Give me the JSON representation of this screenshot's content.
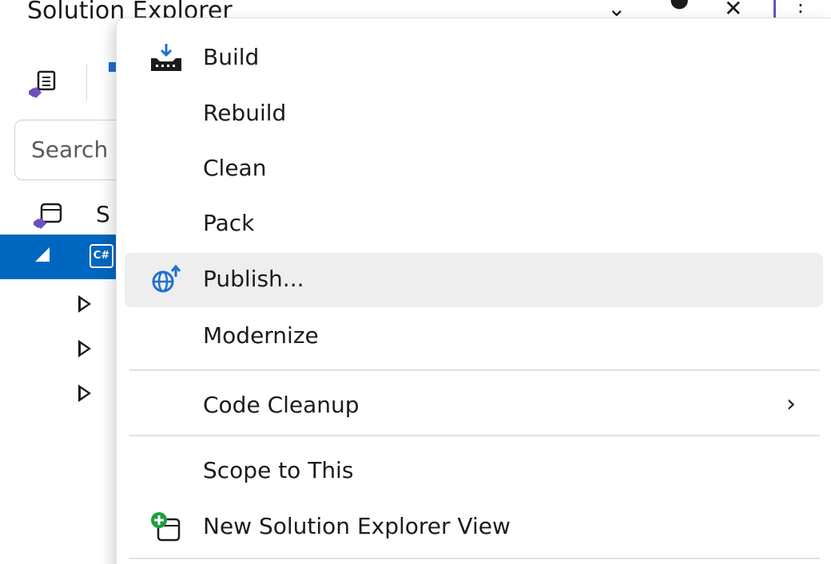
{
  "panel": {
    "title": "Solution Explorer",
    "search_placeholder": "Search",
    "solution_label_partial": "S",
    "project_icon_text": "C#"
  },
  "context_menu": {
    "items": [
      {
        "label": "Build",
        "icon": "build-icon"
      },
      {
        "label": "Rebuild"
      },
      {
        "label": "Clean"
      },
      {
        "label": "Pack"
      },
      {
        "label": "Publish...",
        "icon": "publish-globe-icon",
        "hovered": true
      },
      {
        "label": "Modernize"
      },
      {
        "label": "Code Cleanup",
        "has_submenu": true
      },
      {
        "label": "Scope to This"
      },
      {
        "label": "New Solution Explorer View",
        "icon": "new-view-icon"
      }
    ]
  },
  "colors": {
    "selection": "#0067c0",
    "hover": "#eeeeee",
    "accent_green": "#1e9e3e",
    "accent_blue": "#1f6fd0",
    "vs_purple": "#6b4fbb"
  }
}
